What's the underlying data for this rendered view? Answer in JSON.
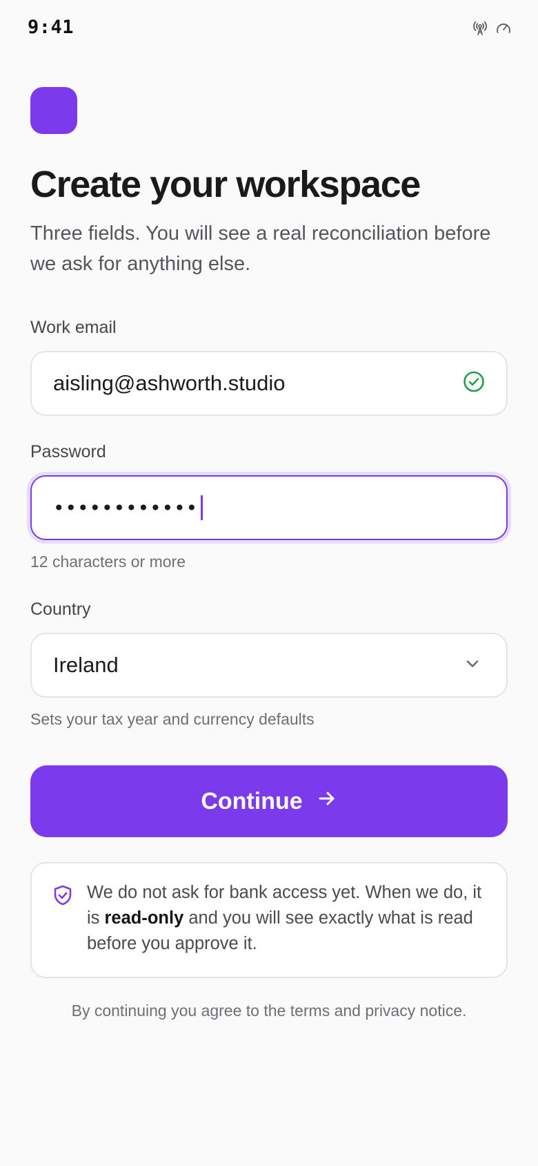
{
  "status_bar": {
    "time": "9:41",
    "icons": [
      "antenna-icon",
      "gauge-icon"
    ]
  },
  "brand": {
    "logo_icon": "app-logo-square",
    "accent_color": "#7c3aed"
  },
  "header": {
    "title": "Create your workspace",
    "subtitle": "Three fields. You will see a real reconciliation before we ask for anything else."
  },
  "form": {
    "email": {
      "label": "Work email",
      "value": "aisling@ashworth.studio",
      "status_icon": "check-circle-icon",
      "status_color": "#1f9d4c"
    },
    "password": {
      "label": "Password",
      "masked_value": "••••••••••••",
      "help": "12 characters or more",
      "focused": true
    },
    "country": {
      "label": "Country",
      "selected": "Ireland",
      "help": "Sets your tax year and currency defaults"
    }
  },
  "continue_button": {
    "label": "Continue",
    "icon": "arrow-right-icon"
  },
  "notice": {
    "icon": "shield-check-icon",
    "text_before": "We do not ask for bank access yet. When we do, it is ",
    "text_bold": "read-only",
    "text_after": " and you will see exactly what is read before you approve it."
  },
  "footer": {
    "terms": "By continuing you agree to the terms and privacy notice."
  }
}
